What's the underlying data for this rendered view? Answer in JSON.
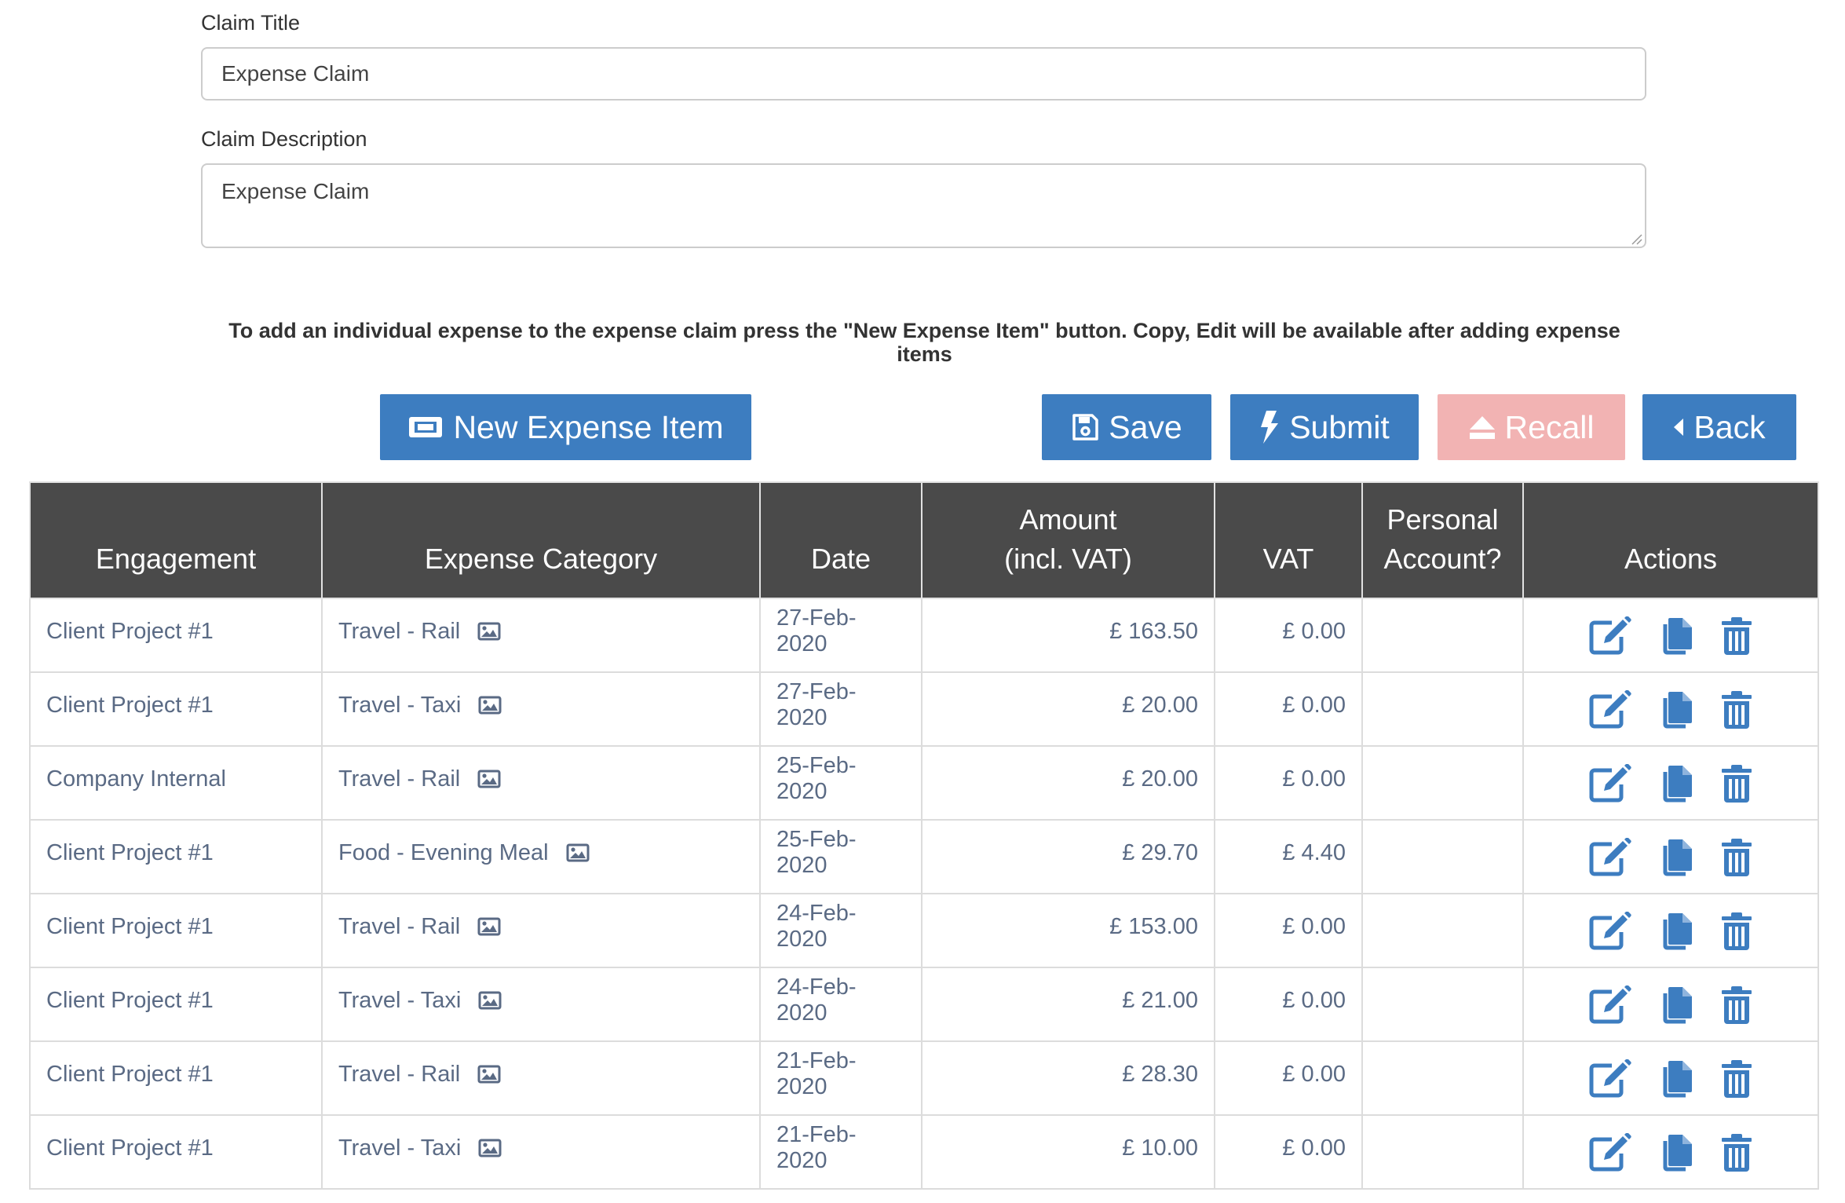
{
  "form": {
    "title_label": "Claim Title",
    "title_value": "Expense Claim",
    "description_label": "Claim Description",
    "description_value": "Expense Claim",
    "help_text": "To add an individual expense to the expense claim press the \"New Expense Item\" button. Copy, Edit will be available after adding expense items"
  },
  "toolbar": {
    "new_item_label": "New Expense Item",
    "save_label": "Save",
    "submit_label": "Submit",
    "recall_label": "Recall",
    "back_label": "Back"
  },
  "colors": {
    "primary": "#3d7dc0",
    "recall_disabled": "#f2b3b3",
    "header_bg": "#4a4a4a",
    "cell_text": "#5a6a84"
  },
  "table": {
    "headers": {
      "engagement": "Engagement",
      "category": "Expense Category",
      "date": "Date",
      "amount_line1": "Amount",
      "amount_line2": "(incl. VAT)",
      "vat": "VAT",
      "personal_line1": "Personal",
      "personal_line2": "Account?",
      "actions": "Actions"
    },
    "row_icons": {
      "receipt": "image-icon",
      "edit": "edit-icon",
      "copy": "copy-icon",
      "delete": "trash-icon"
    },
    "rows": [
      {
        "engagement": "Client Project #1",
        "category": "Travel - Rail",
        "date": "27-Feb-2020",
        "amount": "£ 163.50",
        "vat": "£ 0.00",
        "personal": ""
      },
      {
        "engagement": "Client Project #1",
        "category": "Travel - Taxi",
        "date": "27-Feb-2020",
        "amount": "£ 20.00",
        "vat": "£ 0.00",
        "personal": ""
      },
      {
        "engagement": "Company Internal",
        "category": "Travel - Rail",
        "date": "25-Feb-2020",
        "amount": "£ 20.00",
        "vat": "£ 0.00",
        "personal": ""
      },
      {
        "engagement": "Client Project #1",
        "category": "Food - Evening Meal",
        "date": "25-Feb-2020",
        "amount": "£ 29.70",
        "vat": "£ 4.40",
        "personal": ""
      },
      {
        "engagement": "Client Project #1",
        "category": "Travel - Rail",
        "date": "24-Feb-2020",
        "amount": "£ 153.00",
        "vat": "£ 0.00",
        "personal": ""
      },
      {
        "engagement": "Client Project #1",
        "category": "Travel - Taxi",
        "date": "24-Feb-2020",
        "amount": "£ 21.00",
        "vat": "£ 0.00",
        "personal": ""
      },
      {
        "engagement": "Client Project #1",
        "category": "Travel - Rail",
        "date": "21-Feb-2020",
        "amount": "£ 28.30",
        "vat": "£ 0.00",
        "personal": ""
      },
      {
        "engagement": "Client Project #1",
        "category": "Travel - Taxi",
        "date": "21-Feb-2020",
        "amount": "£ 10.00",
        "vat": "£ 0.00",
        "personal": ""
      }
    ]
  }
}
